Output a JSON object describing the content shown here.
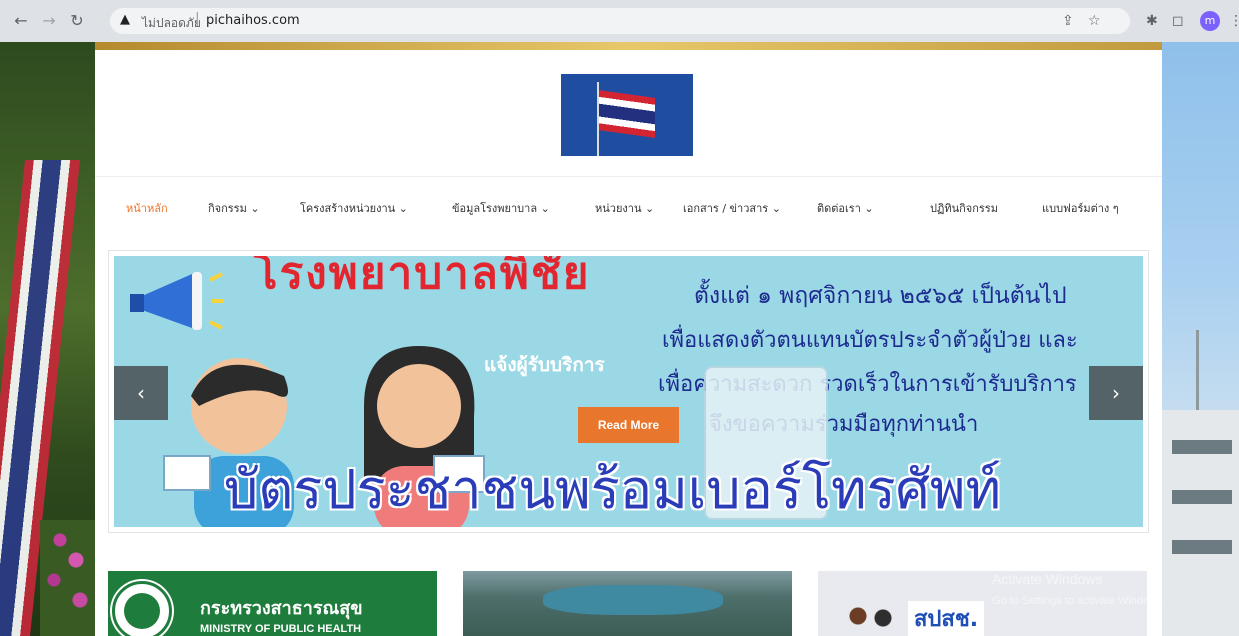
{
  "browser": {
    "security_label": "ไม่ปลอดภัย",
    "separator": "|",
    "url": "pichaihos.com",
    "profile_initial": "m"
  },
  "site": {
    "menu": [
      {
        "label": "หน้าหลัก",
        "active": true
      },
      {
        "label": "กิจกรรม ⌄"
      },
      {
        "label": "โครงสร้างหน่วยงาน ⌄"
      },
      {
        "label": "ข้อมูลโรงพยาบาล ⌄"
      },
      {
        "label": "หน่วยงาน ⌄"
      },
      {
        "label": "เอกสาร / ข่าวสาร ⌄"
      },
      {
        "label": "ติดต่อเรา ⌄"
      },
      {
        "label": "ปฏิทินกิจกรรม"
      },
      {
        "label": "แบบฟอร์มต่าง ๆ"
      }
    ],
    "slider": {
      "headline": "โรงพยาบาลพิชัย",
      "line1": "ตั้งแต่ ๑ พฤศจิกายน ๒๕๖๕ เป็นต้นไป",
      "line2": "เพื่อแสดงตัวตนแทนบัตรประจำตัวผู้ป่วย และ",
      "line3": "เพื่อความสะดวก รวดเร็วในการเข้ารับบริการ",
      "line4": "จึงขอความร่วมมือทุกท่านนำ",
      "bottom": "บัตรประชาชนพร้อมเบอร์โทรศัพท์",
      "caption": "แจ้งผู้รับบริการ",
      "read_more": "Read More",
      "prev": "‹",
      "next": "›"
    },
    "cards": [
      {
        "title_th": "กระทรวงสาธารณสุข",
        "title_en": "MINISTRY OF PUBLIC HEALTH"
      },
      {
        "title": ""
      },
      {
        "brand": "สปสช."
      }
    ]
  },
  "os_watermark": {
    "line1": "Activate Windows",
    "line2": "Go to Settings to activate Windows."
  },
  "colors": {
    "accent": "#e8762d",
    "chrome": "#dee1e6"
  }
}
